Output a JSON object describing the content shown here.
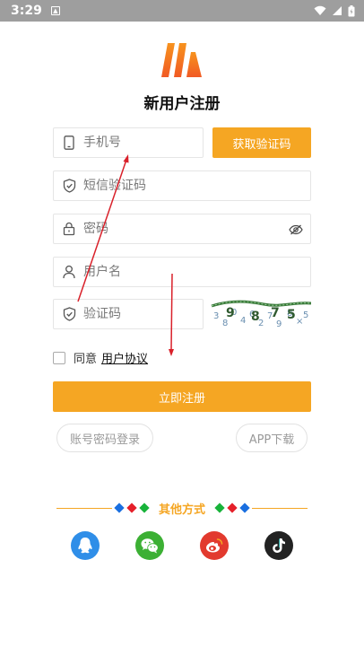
{
  "status_bar": {
    "time": "3:29"
  },
  "page": {
    "title": "新用户注册"
  },
  "form": {
    "phone_placeholder": "手机号",
    "get_code_label": "获取验证码",
    "sms_code_placeholder": "短信验证码",
    "password_placeholder": "密码",
    "username_placeholder": "用户名",
    "captcha_placeholder": "验证码",
    "agree_text": "同意",
    "agreement_link": "用户协议",
    "register_label": "立即注册"
  },
  "links": {
    "account_login": "账号密码登录",
    "app_download": "APP下载"
  },
  "other_methods": {
    "label": "其他方式",
    "icons": [
      "qq-icon",
      "wechat-icon",
      "weibo-icon",
      "douyin-icon"
    ]
  },
  "colors": {
    "accent": "#f5a623",
    "qq": "#2f8ee8",
    "wechat": "#3cb034",
    "weibo": "#e23a2e",
    "douyin": "#222222",
    "annotation_arrow": "#d9202a"
  }
}
